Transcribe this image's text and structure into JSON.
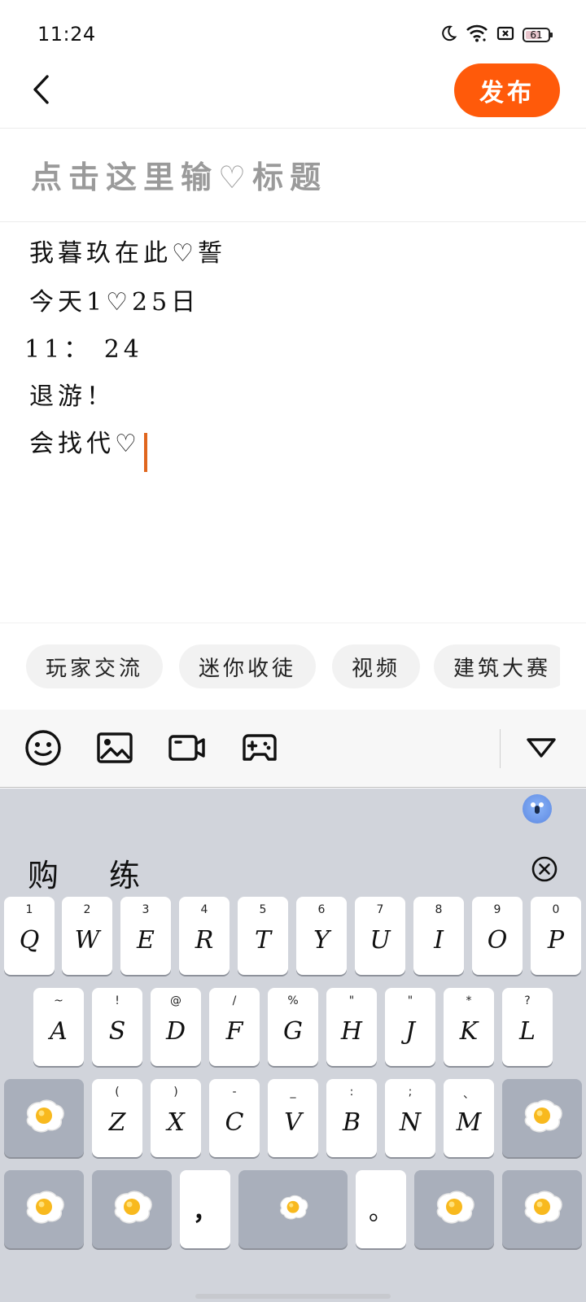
{
  "status_bar": {
    "time": "11:24",
    "battery": "61",
    "icons": [
      "moon-icon",
      "wifi-icon",
      "sim-off-icon",
      "battery-icon"
    ]
  },
  "nav": {
    "back_icon": "chevron-left-icon",
    "publish_label": "发布"
  },
  "editor": {
    "title_placeholder": "点击这里输♡标题",
    "body_lines": [
      "我暮玖在此♡誓",
      "今天1♡25日",
      "11： 24",
      "退游！",
      "会找代♡"
    ]
  },
  "tags": [
    "玩家交流",
    "迷你收徒",
    "视频",
    "建筑大赛"
  ],
  "toolbar": {
    "icons": [
      "emoji-icon",
      "image-icon",
      "video-icon",
      "gamepad-icon",
      "collapse-triangle-icon"
    ]
  },
  "keyboard": {
    "candidates": [
      "购",
      "练"
    ],
    "row1": [
      {
        "hint": "1",
        "key": "Q"
      },
      {
        "hint": "2",
        "key": "W"
      },
      {
        "hint": "3",
        "key": "E"
      },
      {
        "hint": "4",
        "key": "R"
      },
      {
        "hint": "5",
        "key": "T"
      },
      {
        "hint": "6",
        "key": "Y"
      },
      {
        "hint": "7",
        "key": "U"
      },
      {
        "hint": "8",
        "key": "I"
      },
      {
        "hint": "9",
        "key": "O"
      },
      {
        "hint": "0",
        "key": "P"
      }
    ],
    "row2": [
      {
        "hint": "~",
        "key": "A"
      },
      {
        "hint": "!",
        "key": "S"
      },
      {
        "hint": "@",
        "key": "D"
      },
      {
        "hint": "/",
        "key": "F"
      },
      {
        "hint": "%",
        "key": "G"
      },
      {
        "hint": "\"",
        "key": "H"
      },
      {
        "hint": "\"",
        "key": "J"
      },
      {
        "hint": "*",
        "key": "K"
      },
      {
        "hint": "?",
        "key": "L"
      }
    ],
    "row3": [
      {
        "hint": "(",
        "key": "Z"
      },
      {
        "hint": ")",
        "key": "X"
      },
      {
        "hint": "-",
        "key": "C"
      },
      {
        "hint": "_",
        "key": "V"
      },
      {
        "hint": ":",
        "key": "B"
      },
      {
        "hint": ";",
        "key": "N"
      },
      {
        "hint": "、",
        "key": "M"
      }
    ],
    "comma": "，",
    "period": "。"
  }
}
